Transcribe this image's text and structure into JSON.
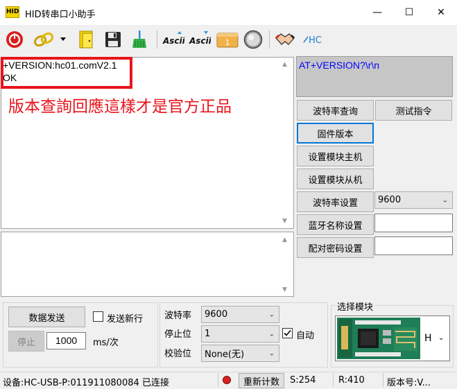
{
  "window": {
    "title": "HID转串口小助手",
    "icon_text": "HID",
    "minimize": "—",
    "maximize": "☐",
    "close": "✕"
  },
  "toolbar": {
    "icons": [
      "power-icon",
      "link-icon",
      "dropdown-arrow-icon",
      "open-file-icon",
      "save-icon",
      "broom-clear-icon",
      "ascii-send-icon",
      "ascii-receive-icon",
      "counter-icon",
      "circle-icon",
      "handshake-icon",
      "hc-logo-icon"
    ],
    "ascii1": "Ascii",
    "ascii2": "Ascii",
    "counter_label": "1",
    "hc_label": "HC"
  },
  "receive": {
    "line1": "+VERSION:hc01.comV2.1",
    "line2": "OK",
    "annotation": "版本查詢回應這樣才是官方正品"
  },
  "command_box": {
    "text": "AT+VERSION?\\r\\n"
  },
  "buttons": {
    "baud_query": "波特率查询",
    "test_cmd": "测试指令",
    "firmware": "固件版本",
    "set_master": "设置模块主机",
    "set_slave": "设置模块从机",
    "set_baud": "波特率设置",
    "set_name": "蓝牙名称设置",
    "set_pin": "配对密码设置",
    "send_data": "数据发送",
    "stop": "停止",
    "reset_count": "重新计数"
  },
  "baud_select_right": "9600",
  "send_options": {
    "newline_label": "发送新行",
    "newline_checked": false,
    "interval_value": "1000",
    "interval_unit": "ms/次"
  },
  "serial_settings": {
    "baud_label": "波特率",
    "baud_value": "9600",
    "stop_label": "停止位",
    "stop_value": "1",
    "parity_label": "校验位",
    "parity_value": "None(无)",
    "auto_label": "自动",
    "auto_checked": true
  },
  "module_select": {
    "label": "选择模块",
    "value": "H"
  },
  "status": {
    "device": "设备:HC-USB-P:011911080084 已连接",
    "sent": "S:254",
    "received": "R:410",
    "version": "版本号:V...",
    "indicator_color": "#d92020"
  },
  "colors": {
    "annotation_red": "#e8141c",
    "command_blue": "#0000ff",
    "focus_blue": "#0078d7"
  }
}
